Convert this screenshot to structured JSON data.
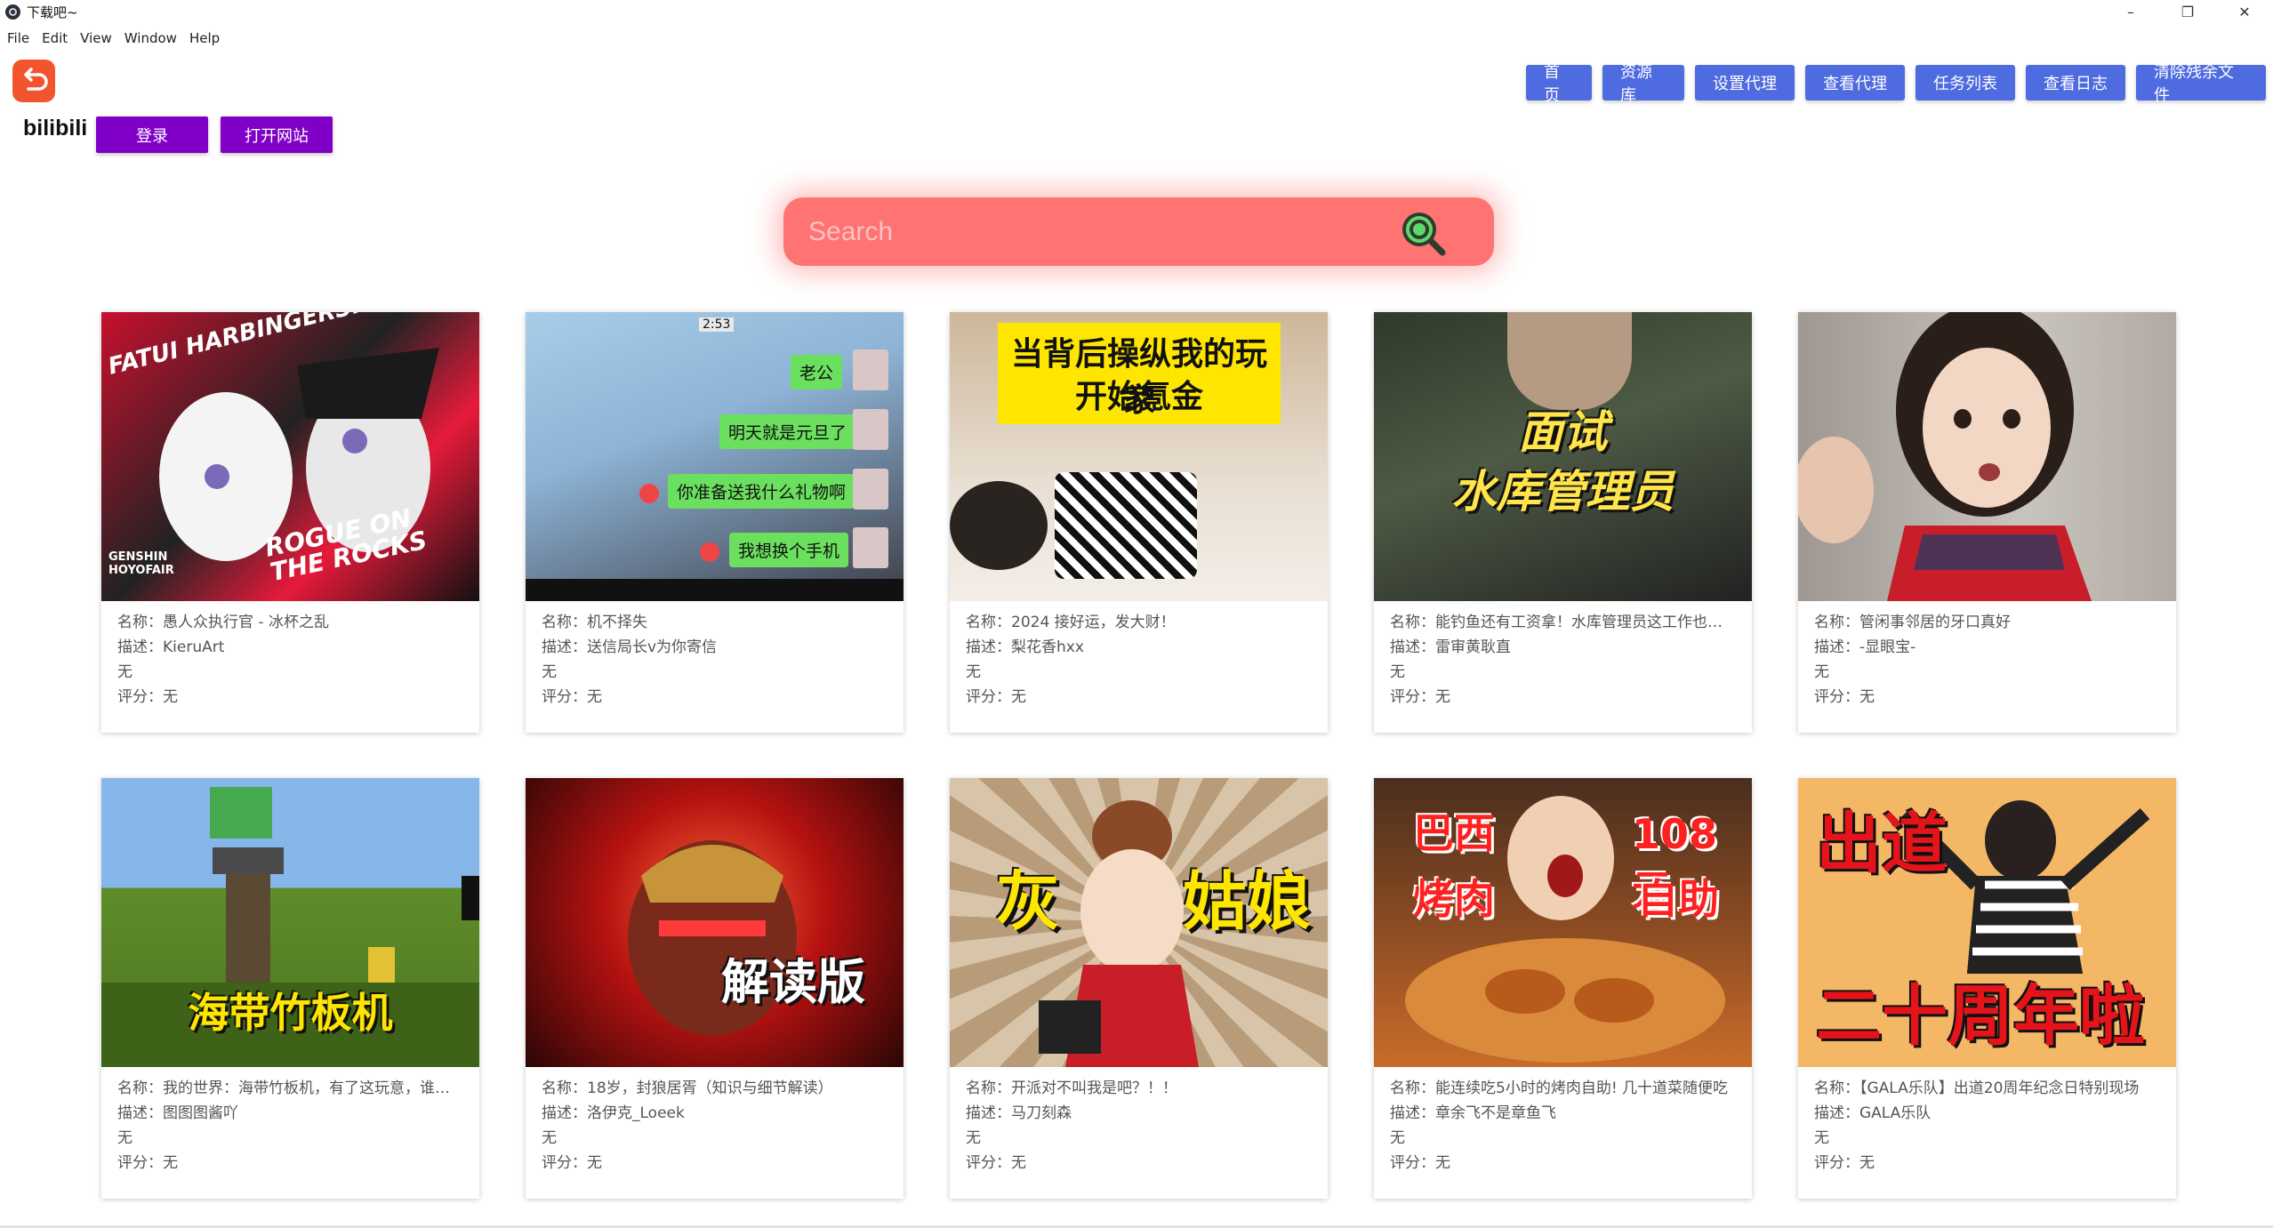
{
  "window": {
    "title": "下载吧~",
    "controls": [
      "–",
      "❐",
      "✕"
    ]
  },
  "menu": [
    "File",
    "Edit",
    "View",
    "Window",
    "Help"
  ],
  "header": {
    "site_name": "bilibili",
    "login_label": "登录",
    "open_site_label": "打开网站",
    "nav": [
      "首页",
      "资源库",
      "设置代理",
      "查看代理",
      "任务列表",
      "查看日志",
      "清除残余文件"
    ]
  },
  "search": {
    "placeholder": "Search"
  },
  "colors": {
    "search_bg": "#ff7373",
    "nav_btn": "#4f6be0",
    "purple_btn": "#8000c8",
    "logo": "#f2542d"
  },
  "cards": [
    {
      "name": "名称：愚人众执行官 - 冰杯之乱",
      "desc": "描述：KieruArt",
      "extra": "无",
      "rating": "评分：无",
      "thumb": {
        "texts": [
          "FATUI HARBINGERS:",
          "ROGUE ON THE ROCKS",
          "GENSHIN HOYOFAIR"
        ]
      }
    },
    {
      "name": "名称：机不择失",
      "desc": "描述：送信局长v为你寄信",
      "extra": "无",
      "rating": "评分：无",
      "thumb": {
        "texts": [
          "2:53",
          "老公",
          "明天就是元旦了",
          "你准备送我什么礼物啊",
          "我想换个手机"
        ]
      }
    },
    {
      "name": "名称：2024 接好运，发大财！",
      "desc": "描述：梨花香hxx",
      "extra": "无",
      "rating": "评分：无",
      "thumb": {
        "texts": [
          "当背后操纵我的玩家",
          "开始氪金"
        ]
      }
    },
    {
      "name": "名称：能钓鱼还有工资拿！水库管理员这工作也太爽了",
      "desc": "描述：雷审黄耿直",
      "extra": "无",
      "rating": "评分：无",
      "thumb": {
        "texts": [
          "面试",
          "水库管理员"
        ]
      }
    },
    {
      "name": "名称：管闲事邻居的牙口真好",
      "desc": "描述：-显眼宝-",
      "extra": "无",
      "rating": "评分：无",
      "thumb": {
        "texts": []
      }
    },
    {
      "name": "名称：我的世界：海带竹板机，有了这玩意，谁还种田啊",
      "desc": "描述：图图图酱吖",
      "extra": "无",
      "rating": "评分：无",
      "thumb": {
        "texts": [
          "海带竹板机"
        ]
      }
    },
    {
      "name": "名称：18岁，封狼居胥（知识与细节解读）",
      "desc": "描述：洛伊克_Loeek",
      "extra": "无",
      "rating": "评分：无",
      "thumb": {
        "texts": [
          "解读版"
        ]
      }
    },
    {
      "name": "名称：开派对不叫我是吧？！！",
      "desc": "描述：马刀刻森",
      "extra": "无",
      "rating": "评分：无",
      "thumb": {
        "texts": [
          "灰",
          "姑娘"
        ]
      }
    },
    {
      "name": "名称：能连续吃5小时的烤肉自助! 几十道菜随便吃",
      "desc": "描述：章余飞不是章鱼飞",
      "extra": "无",
      "rating": "评分：无",
      "thumb": {
        "texts": [
          "巴西",
          "烤肉",
          "108元",
          "自助"
        ]
      }
    },
    {
      "name": "名称：【GALA乐队】出道20周年纪念日特别现场",
      "desc": "描述：GALA乐队",
      "extra": "无",
      "rating": "评分：无",
      "thumb": {
        "texts": [
          "出道",
          "二十周年啦"
        ]
      }
    }
  ]
}
